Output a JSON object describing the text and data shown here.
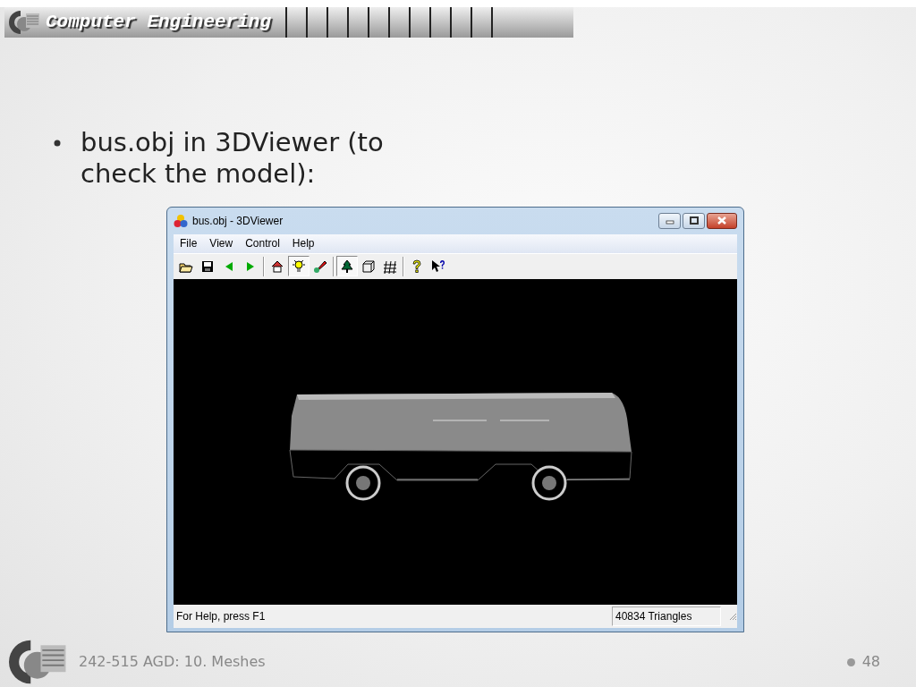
{
  "header": {
    "title": "Computer Engineering"
  },
  "bullets": [
    "bus.obj in 3DViewer (to check the model):"
  ],
  "window": {
    "title": "bus.obj - 3DViewer",
    "menu": [
      "File",
      "View",
      "Control",
      "Help"
    ],
    "toolbar": [
      {
        "kind": "open",
        "pressed": false
      },
      {
        "kind": "save",
        "pressed": false
      },
      {
        "kind": "back",
        "pressed": false
      },
      {
        "kind": "forward",
        "pressed": false
      },
      {
        "kind": "separator"
      },
      {
        "kind": "home",
        "pressed": false
      },
      {
        "kind": "light",
        "pressed": true
      },
      {
        "kind": "paint",
        "pressed": false
      },
      {
        "kind": "separator"
      },
      {
        "kind": "tree",
        "pressed": true
      },
      {
        "kind": "cube",
        "pressed": false
      },
      {
        "kind": "grid",
        "pressed": false
      },
      {
        "kind": "separator"
      },
      {
        "kind": "help",
        "pressed": false
      },
      {
        "kind": "context-help",
        "pressed": false
      }
    ],
    "status_bar": {
      "message": "For Help, press F1",
      "triangles": "40834 Triangles"
    }
  },
  "footer": {
    "text": "242-515 AGD: 10. Meshes",
    "page": "48"
  }
}
